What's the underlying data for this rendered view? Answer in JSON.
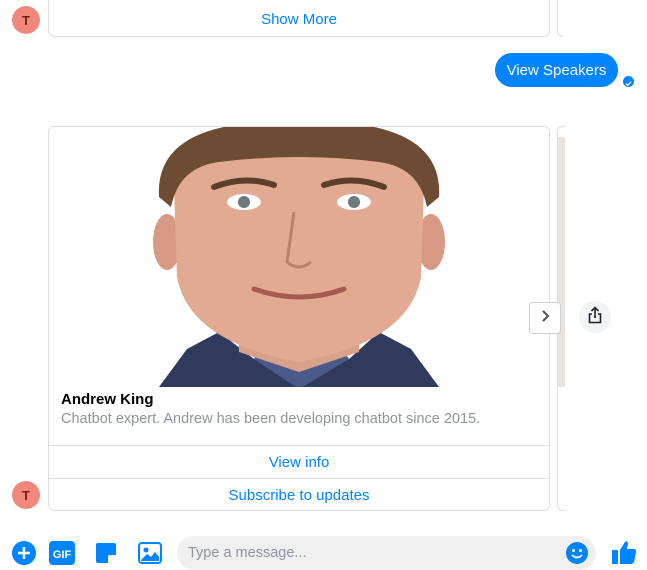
{
  "avatar_initial": "T",
  "top_card": {
    "button_label": "Show More"
  },
  "outgoing_message": {
    "text": "View Speakers"
  },
  "speaker_card": {
    "title": "Andrew King",
    "subtitle": "Chatbot expert. Andrew has been developing chatbot since 2015.",
    "buttons": [
      "View info",
      "Subscribe to updates"
    ]
  },
  "composer": {
    "placeholder": "Type a message...",
    "gif_label": "GIF"
  },
  "colors": {
    "accent": "#0084ff",
    "avatar": "#f0897c",
    "border": "#dddfe2",
    "muted_text": "#90949c"
  },
  "icons": [
    "plus-icon",
    "gif-icon",
    "sticker-icon",
    "photo-icon",
    "emoji-icon",
    "thumbs-up-icon",
    "chevron-right-icon",
    "share-icon",
    "seen-check-icon"
  ]
}
